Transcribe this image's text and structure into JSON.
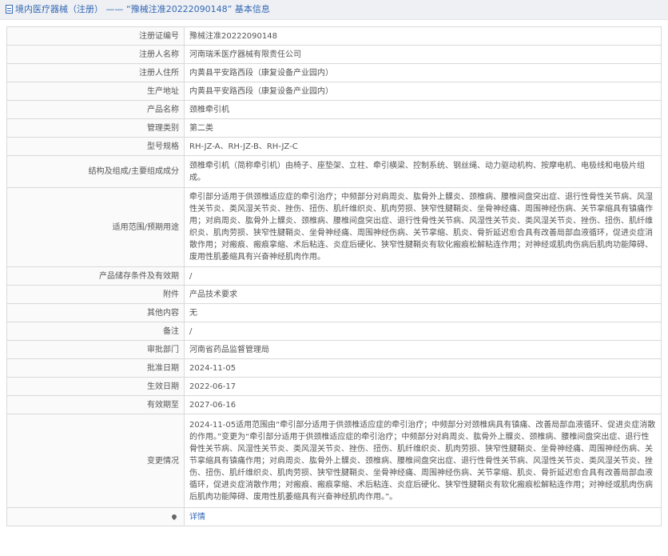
{
  "header": {
    "title": "境内医疗器械（注册） —— “豫械注准20222090148” 基本信息"
  },
  "rows": [
    {
      "label": "注册证编号",
      "value": "豫械注准20222090148"
    },
    {
      "label": "注册人名称",
      "value": "河南瑞禾医疗器械有限责任公司"
    },
    {
      "label": "注册人住所",
      "value": "内黄县平安路西段（康复设备产业园内）"
    },
    {
      "label": "生产地址",
      "value": "内黄县平安路西段（康复设备产业园内）"
    },
    {
      "label": "产品名称",
      "value": "颈椎牵引机"
    },
    {
      "label": "管理类别",
      "value": "第二类"
    },
    {
      "label": "型号规格",
      "value": "RH-JZ-A、RH-JZ-B、RH-JZ-C"
    },
    {
      "label": "结构及组成/主要组成成分",
      "value": "颈椎牵引机（简称牵引机）由椅子、座垫架、立柱、牵引横梁、控制系统、钢丝绳、动力驱动机构、按摩电机、电极线和电极片组成。"
    },
    {
      "label": "适用范围/预期用途",
      "value": "牵引部分适用于供颈椎适应症的牵引治疗；中频部分对肩周炎、肱骨外上髁炎、颈椎病、腰椎间盘突出症、退行性骨性关节病、风湿性关节炎、类风湿关节炎、挫伤、扭伤、肌纤维织炎、肌肉劳损、狭窄性腱鞘炎、坐骨神经痛、周围神经伤病、关节挛缩具有镇痛作用；对肩周炎、肱骨外上髁炎、颈椎病、腰椎间盘突出症、退行性骨性关节病、风湿性关节炎、类风湿关节炎、挫伤、扭伤、肌纤维织炎、肌肉劳损、狭窄性腱鞘炎、坐骨神经痛、周围神经伤病、关节挛缩、肌炎、骨折延迟愈合具有改善局部血液循环，促进炎症消散作用；对瘢痕、瘢痕挛缩、术后粘连、炎症后硬化、狭窄性腱鞘炎有软化瘢痕松解粘连作用；对神经或肌肉伤病后肌肉功能障碍、废用性肌萎缩具有兴奋神经肌肉作用。"
    },
    {
      "label": "产品储存条件及有效期",
      "value": "/"
    },
    {
      "label": "附件",
      "value": "产品技术要求"
    },
    {
      "label": "其他内容",
      "value": "无"
    },
    {
      "label": "备注",
      "value": "/"
    },
    {
      "label": "审批部门",
      "value": "河南省药品监督管理局"
    },
    {
      "label": "批准日期",
      "value": "2024-11-05"
    },
    {
      "label": "生效日期",
      "value": "2022-06-17"
    },
    {
      "label": "有效期至",
      "value": "2027-06-16"
    },
    {
      "label": "变更情况",
      "value": "2024-11-05适用范围由“牵引部分适用于供颈椎适应症的牵引治疗；中频部分对颈椎病具有镇痛、改善局部血液循环、促进炎症消散的作用。”变更为“牵引部分适用于供颈椎适应症的牵引治疗；中频部分对肩周炎、肱骨外上髁炎、颈椎病、腰椎间盘突出症、退行性骨性关节病、风湿性关节炎、类风湿关节炎、挫伤、扭伤、肌纤维织炎、肌肉劳损、狭窄性腱鞘炎、坐骨神经痛、周围神经伤病、关节挛缩具有镇痛作用；对肩周炎、肱骨外上髁炎、颈椎病、腰椎间盘突出症、退行性骨性关节病、风湿性关节炎、类风湿关节炎、挫伤、扭伤、肌纤维织炎、肌肉劳损、狭窄性腱鞘炎、坐骨神经痛、周围神经伤病、关节挛缩、肌炎、骨折延迟愈合具有改善局部血液循环，促进炎症消散作用；对瘢痕、瘢痕挛缩、术后粘连、炎症后硬化、狭窄性腱鞘炎有软化瘢痕松解粘连作用；对神经或肌肉伤病后肌肉功能障碍、废用性肌萎缩具有兴奋神经肌肉作用。”。"
    }
  ],
  "detail": {
    "icon": "map-pin-icon",
    "label": "",
    "link_text": "详情"
  }
}
